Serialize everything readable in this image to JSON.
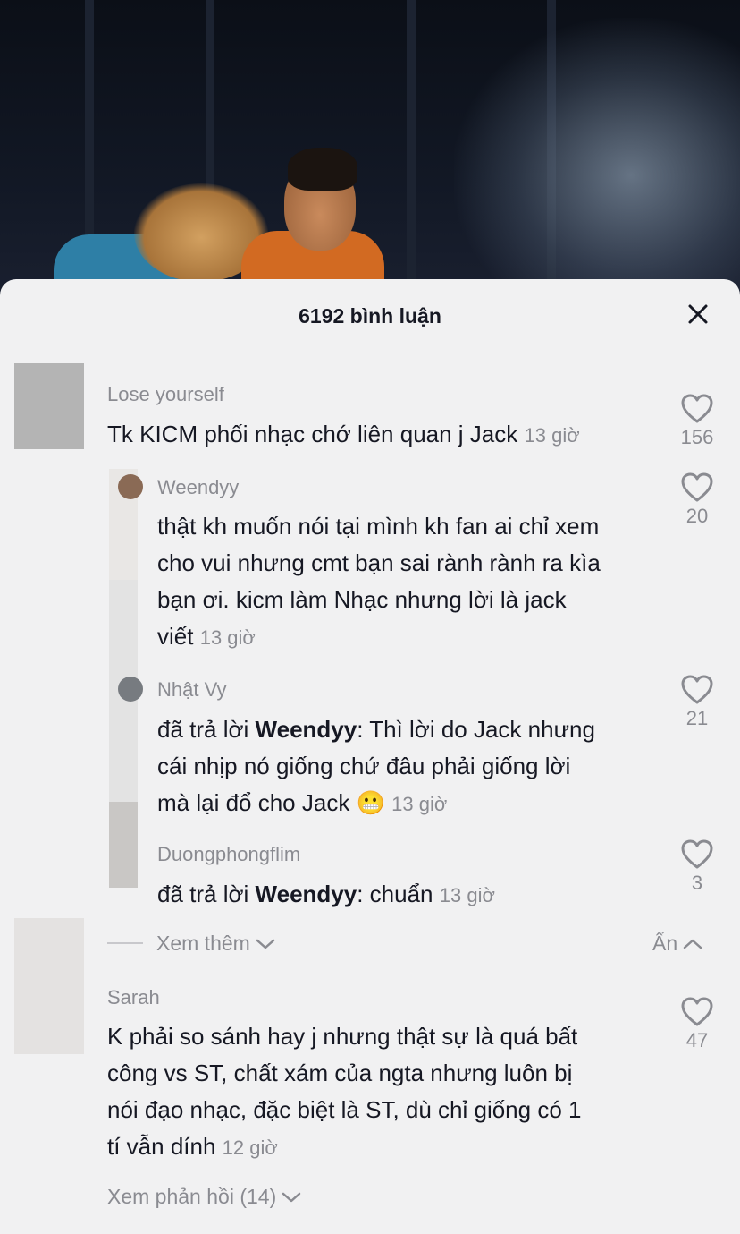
{
  "header": {
    "title": "6192 bình luận"
  },
  "comments": [
    {
      "username": "Lose yourself",
      "text": "Tk KICM phối nhạc chớ liên quan j Jack",
      "time": "13 giờ",
      "likes": "156"
    },
    {
      "username": "Sarah",
      "lines": [
        "K phải so sánh hay j nhưng thật sự là quá bất",
        "công vs ST, chất xám của ngta nhưng luôn bị",
        "nói đạo nhạc, đặc biệt là ST, dù chỉ giống có 1",
        "tí vẫn dính"
      ],
      "time": "12 giờ",
      "likes": "47",
      "view_replies": "Xem phản hồi (14)"
    }
  ],
  "replies": [
    {
      "username": "Weendyy",
      "lines": [
        "thật kh muốn nói tại mình kh fan ai chỉ xem",
        "cho vui nhưng cmt bạn sai rành rành ra kìa",
        "bạn ơi. kicm làm Nhạc nhưng lời là jack",
        "viết"
      ],
      "time": "13 giờ",
      "likes": "20"
    },
    {
      "username": "Nhật Vy",
      "reply_prefix": "đã trả lời ",
      "reply_to": "Weendyy",
      "lines": [
        ": Thì lời do Jack nhưng",
        "cái nhịp nó giống chứ đâu phải giống lời",
        "mà lại đổ cho Jack"
      ],
      "emoji": "😬",
      "time": "13 giờ",
      "likes": "21"
    },
    {
      "username": "Duongphongflim",
      "reply_prefix": "đã trả lời ",
      "reply_to": "Weendyy",
      "text": ": chuẩn",
      "time": "13 giờ",
      "likes": "3"
    }
  ],
  "thread_controls": {
    "see_more": "Xem thêm",
    "hide": "Ẩn"
  },
  "colors": {
    "sheet_bg": "#f1f1f2",
    "text": "#161823",
    "muted": "#8a8b91"
  }
}
